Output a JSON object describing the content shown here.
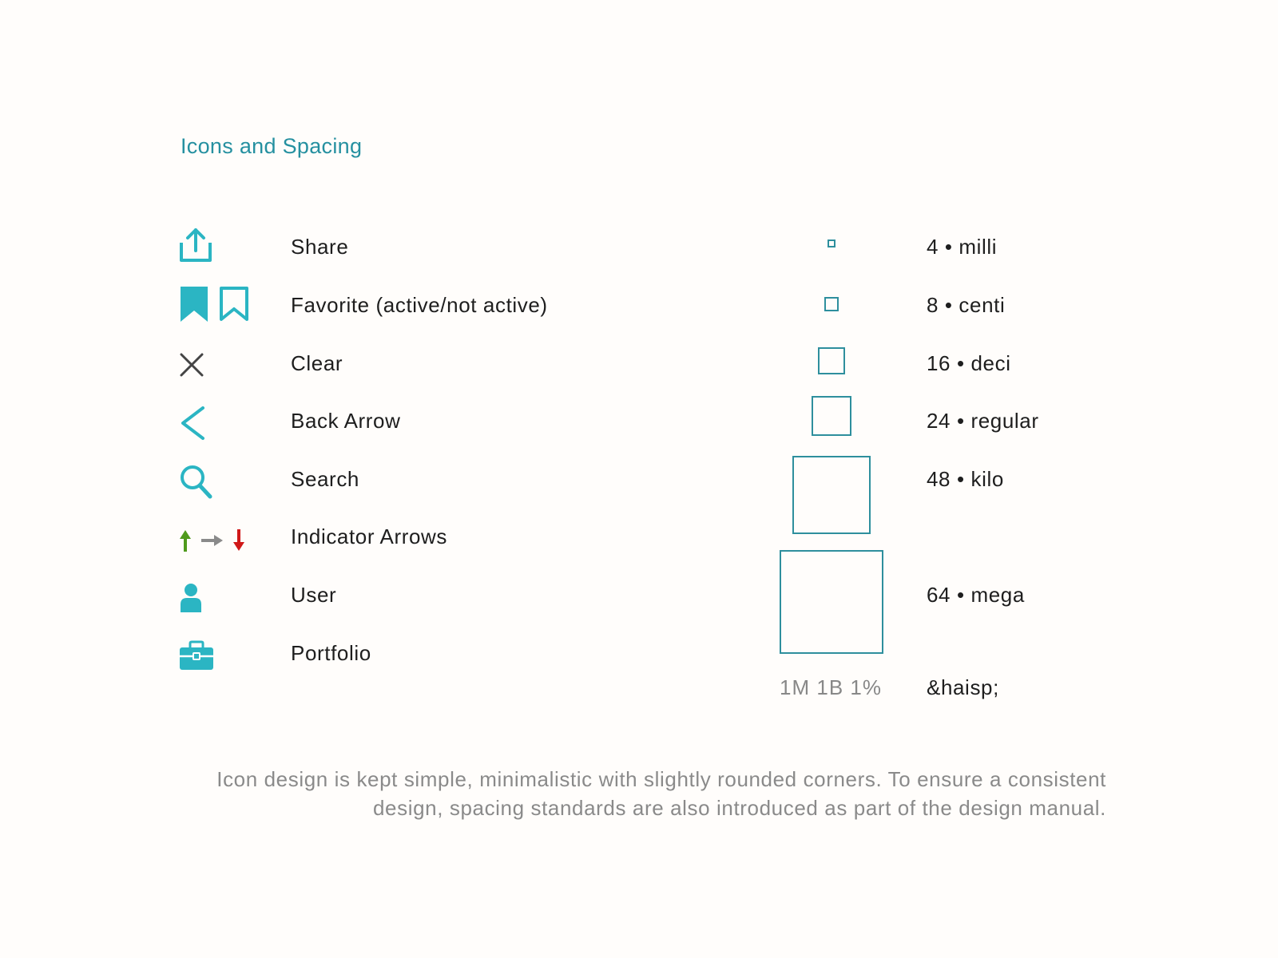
{
  "page": {
    "title": "Icons and Spacing",
    "caption_line1": "Icon design is kept simple, minimalistic with slightly rounded corners. To ensure a consistent",
    "caption_line2": "design, spacing standards are also introduced as part of the design manual."
  },
  "icons": [
    {
      "icon": "share-icon",
      "label": "Share"
    },
    {
      "icon": "bookmark-icon",
      "label": "Favorite (active/not active)"
    },
    {
      "icon": "close-icon",
      "label": "Clear"
    },
    {
      "icon": "chevron-left-icon",
      "label": "Back Arrow"
    },
    {
      "icon": "search-icon",
      "label": "Search"
    },
    {
      "icon": "indicator-arrows-icon",
      "label": "Indicator Arrows"
    },
    {
      "icon": "user-icon",
      "label": "User"
    },
    {
      "icon": "briefcase-icon",
      "label": "Portfolio"
    }
  ],
  "spacing": [
    {
      "size": 4,
      "label": "4 • milli"
    },
    {
      "size": 8,
      "label": "8 • centi"
    },
    {
      "size": 16,
      "label": "16 • deci"
    },
    {
      "size": 24,
      "label": "24 • regular"
    },
    {
      "size": 48,
      "label": "48 • kilo"
    },
    {
      "size": 64,
      "label": "64 • mega"
    }
  ],
  "spacing_footer": {
    "scale_note": "1M 1B 1%",
    "label": "&haisp;"
  },
  "colors": {
    "accent": "#2bb5c3",
    "title": "#2590a0",
    "square_border": "#2e8f9d",
    "icon_dark": "#444444",
    "arrow_up": "#4f9a1c",
    "arrow_flat": "#8a8a8a",
    "arrow_down": "#d01818",
    "caption": "#8a8a8a"
  }
}
